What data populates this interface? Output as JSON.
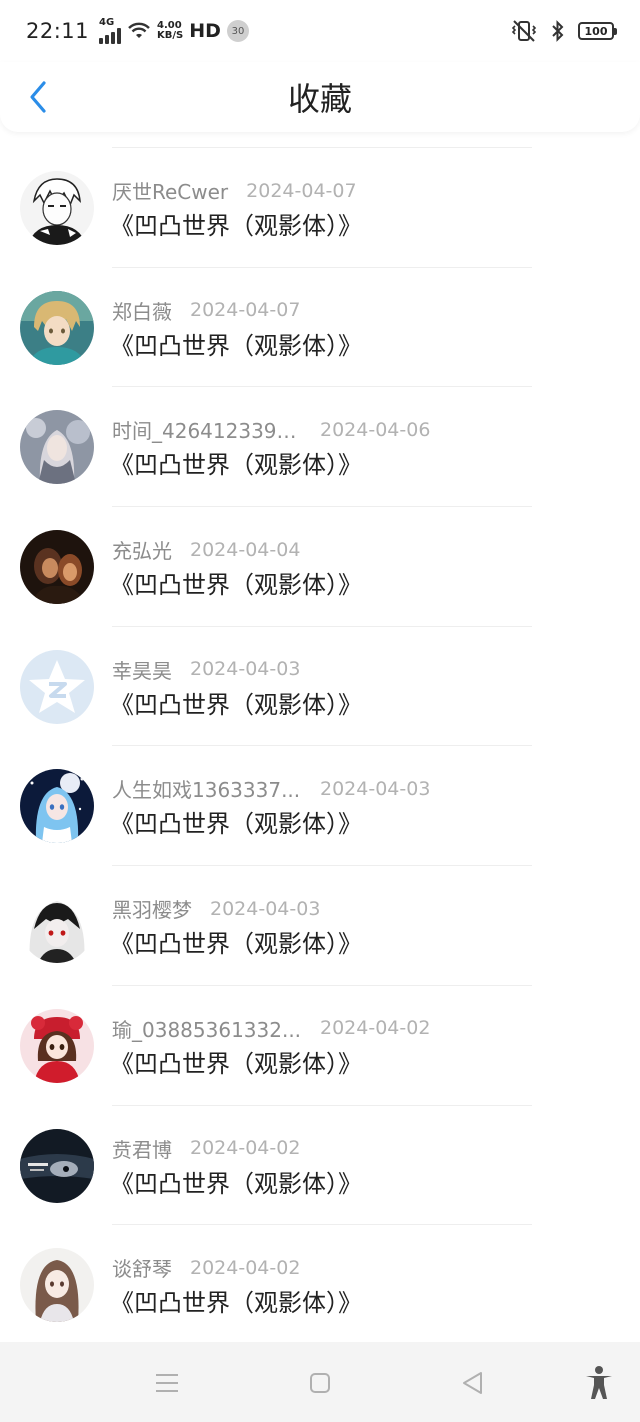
{
  "status_bar": {
    "time": "22:11",
    "network_type": "4G",
    "speed_value": "4.00",
    "speed_unit": "KB/S",
    "hd_label": "HD",
    "notification_count": "30",
    "battery": "100"
  },
  "header": {
    "title": "收藏",
    "back_icon": "chevron-left-icon",
    "accent_color": "#2b8de8"
  },
  "favorites": [
    {
      "name": "厌世ReCwer",
      "date": "2024-04-07",
      "book": "《凹凸世界（观影体）》",
      "avatar": "avatar-manga-boy-bw"
    },
    {
      "name": "郑白薇",
      "date": "2024-04-07",
      "book": "《凹凸世界（观影体）》",
      "avatar": "avatar-anime-blonde-boy"
    },
    {
      "name": "时间_4264123394...",
      "date": "2024-04-06",
      "book": "《凹凸世界（观影体）》",
      "avatar": "avatar-fantasy-girl"
    },
    {
      "name": "充弘光",
      "date": "2024-04-04",
      "book": "《凹凸世界（观影体）》",
      "avatar": "avatar-dark-photo"
    },
    {
      "name": "幸昊昊",
      "date": "2024-04-03",
      "book": "《凹凸世界（观影体）》",
      "avatar": "avatar-default-star"
    },
    {
      "name": "人生如戏1363337...",
      "date": "2024-04-03",
      "book": "《凹凸世界（观影体）》",
      "avatar": "avatar-blue-hair-girl"
    },
    {
      "name": "黑羽樱梦",
      "date": "2024-04-03",
      "book": "《凹凸世界（观影体）》",
      "avatar": "avatar-white-hair-red-eye"
    },
    {
      "name": "瑜_03885361332...",
      "date": "2024-04-02",
      "book": "《凹凸世界（观影体）》",
      "avatar": "avatar-red-dress-girl"
    },
    {
      "name": "贲君博",
      "date": "2024-04-02",
      "book": "《凹凸世界（观影体）》",
      "avatar": "avatar-dark-text-art"
    },
    {
      "name": "谈舒琴",
      "date": "2024-04-02",
      "book": "《凹凸世界（观影体）》",
      "avatar": "avatar-brown-hair-girl"
    }
  ],
  "bottom_nav": {
    "items": [
      "menu-icon",
      "home-square-icon",
      "back-triangle-icon",
      "accessibility-icon"
    ]
  }
}
